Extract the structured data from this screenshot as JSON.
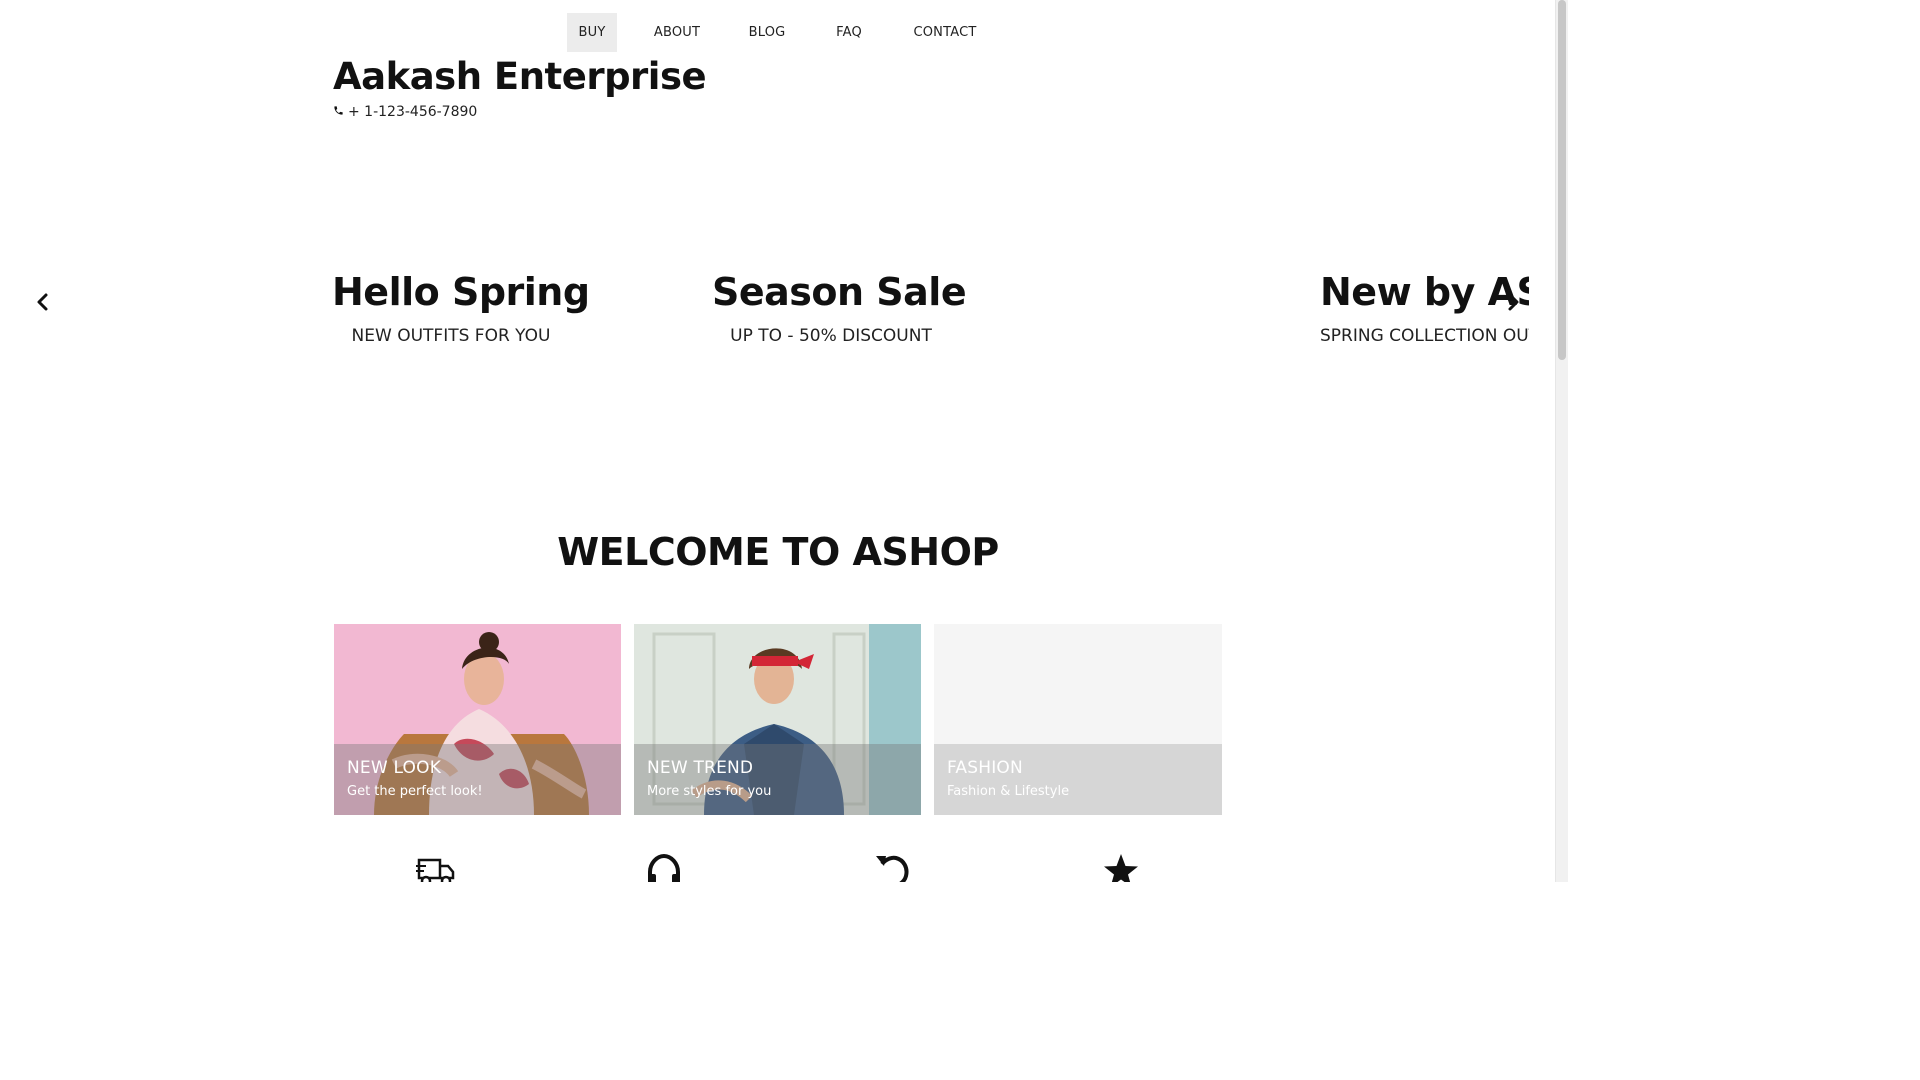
{
  "nav": {
    "items": [
      {
        "label": "BUY",
        "active": true
      },
      {
        "label": "ABOUT"
      },
      {
        "label": "BLOG"
      },
      {
        "label": "FAQ"
      },
      {
        "label": "CONTACT"
      }
    ]
  },
  "brand": {
    "title": "Aakash Enterprise",
    "phone": "+ 1-123-456-7890",
    "phone_icon": "phone-icon"
  },
  "carousel": {
    "slides": [
      {
        "title": "Hello Spring",
        "subtitle": "NEW OUTFITS FOR YOU"
      },
      {
        "title": "Season Sale",
        "subtitle": "UP TO - 50% DISCOUNT"
      },
      {
        "title": "New by AShop",
        "subtitle": "SPRING COLLECTION OUT NOW"
      }
    ],
    "prev_icon": "chevron-left-icon",
    "next_icon": "chevron-right-icon"
  },
  "welcome": {
    "title": "WELCOME TO ASHOP"
  },
  "cards": [
    {
      "title": "NEW LOOK",
      "subtitle": "Get the perfect look!"
    },
    {
      "title": "NEW TREND",
      "subtitle": "More styles for you"
    },
    {
      "title": "FASHION",
      "subtitle": "Fashion & Lifestyle"
    }
  ],
  "features": [
    {
      "icon": "truck-icon"
    },
    {
      "icon": "headphones-icon"
    },
    {
      "icon": "undo-icon"
    },
    {
      "icon": "star-icon"
    }
  ],
  "colors": {
    "text": "#111111",
    "nav_active_bg": "#ececec",
    "card1_bg": "#f3b9d4",
    "card2_bg": "#9fc0c4",
    "card3_bg": "#f5f5f5"
  }
}
